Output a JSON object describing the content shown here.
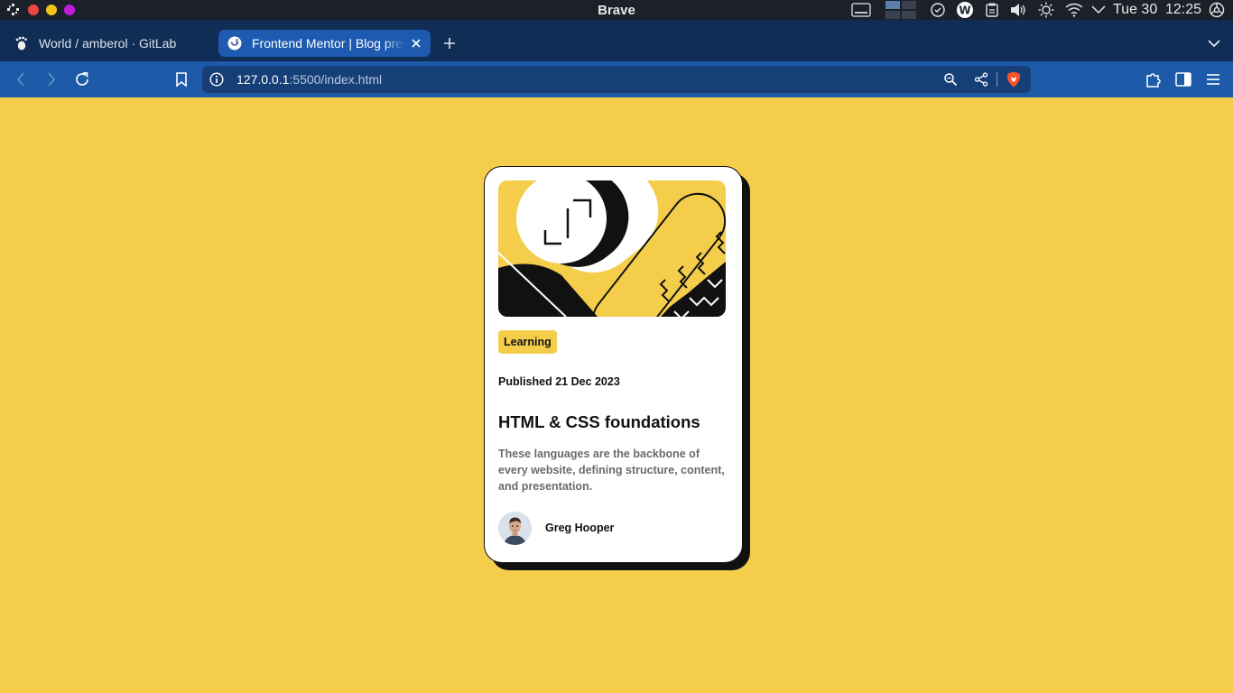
{
  "os": {
    "title": "Brave",
    "date": "Tue 30",
    "time": "12:25"
  },
  "tabs": [
    {
      "label": "World / amberol · GitLab",
      "icon": "gnome-foot-icon"
    },
    {
      "label": "Frontend Mentor | Blog preview card",
      "icon": "frontend-mentor-icon",
      "active": true
    }
  ],
  "address": {
    "host": "127.0.0.1",
    "rest": ":5500/index.html"
  },
  "card": {
    "tag": "Learning",
    "published": "Published 21 Dec 2023",
    "title": "HTML & CSS foundations",
    "description": "These languages are the backbone of every website, defining structure, content, and presentation.",
    "author": "Greg Hooper"
  },
  "colors": {
    "page_background": "#f4ce4a",
    "card_background": "#ffffff",
    "ink": "#111111",
    "muted_text": "#6b6b6b",
    "browser_toolbar": "#1d5aa8",
    "active_tab": "#1d5ab0",
    "brave_orange": "#fb542b"
  }
}
